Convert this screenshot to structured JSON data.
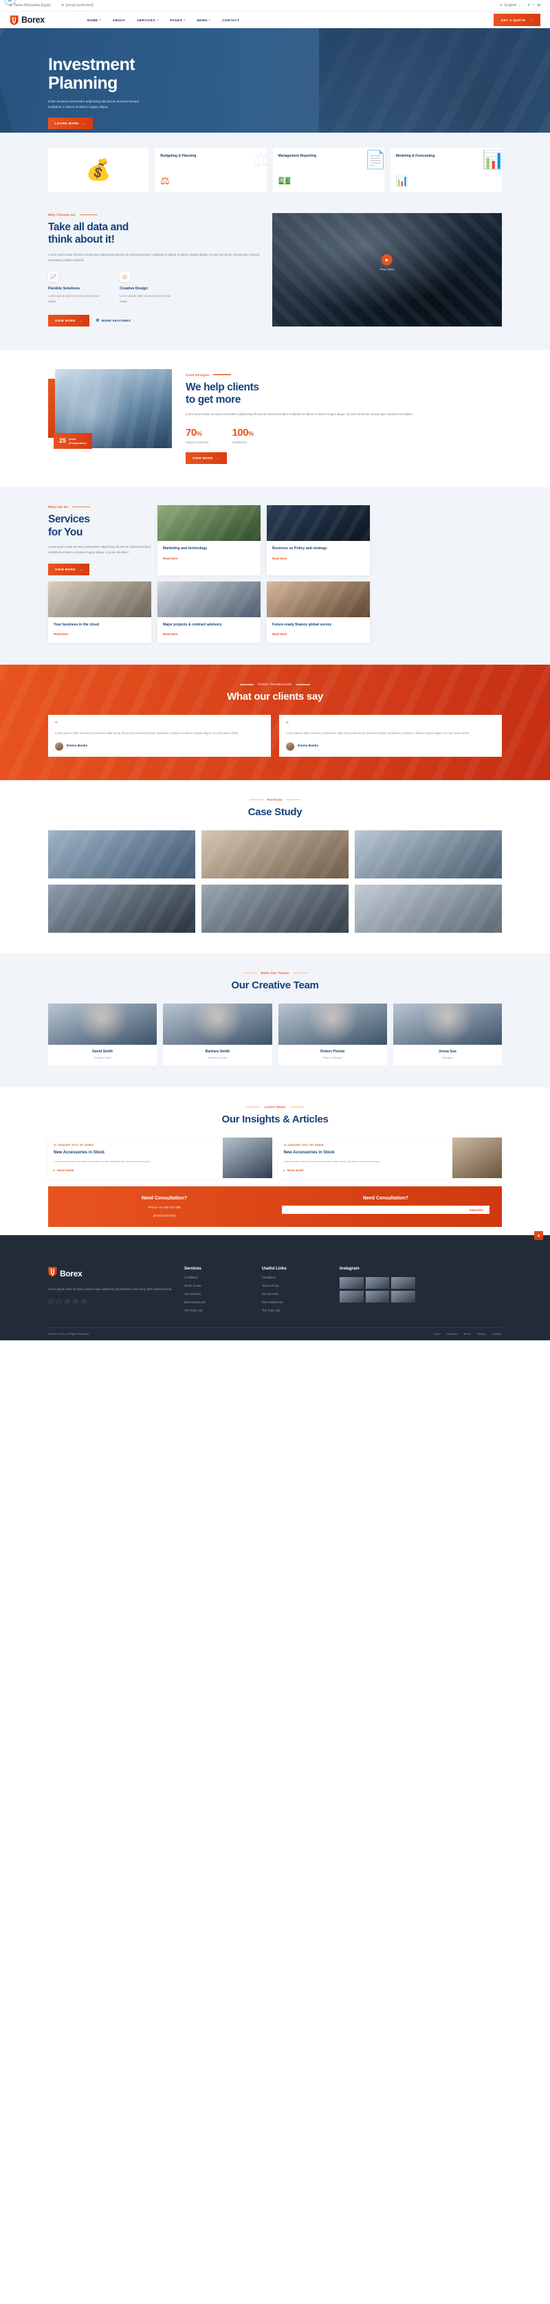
{
  "topbar": {
    "location": "Tanta AlGharbia,Egypt.",
    "location_icon": "map-pin-icon",
    "email": "[email protected]",
    "email_icon": "envelope-icon",
    "language": "English",
    "language_icon": "globe-icon",
    "language_caret": "⌄",
    "social": [
      "f",
      "ᵛ",
      "in"
    ]
  },
  "header": {
    "brand": "Borex",
    "nav": [
      {
        "label": "HOME",
        "caret": "▾"
      },
      {
        "label": "ABOUT",
        "caret": ""
      },
      {
        "label": "SERVICES",
        "caret": "▾"
      },
      {
        "label": "PAGES",
        "caret": "▾"
      },
      {
        "label": "NEWS",
        "caret": "▾"
      },
      {
        "label": "CONTACT",
        "caret": ""
      }
    ],
    "cta": "GET A QUOTE",
    "cta_arrow": "→"
  },
  "hero": {
    "title_line1": "Investment",
    "title_line2": "Planning",
    "paragraph": "Dolor sit amet,consectetur adipisicing elit,sed do eiusmod tempor incididunt ut labore et dolore magna aliqua.",
    "button": "LEARN MORE",
    "button_arrow": "→"
  },
  "feature_cards": [
    {
      "title": "",
      "icon": "money-growth-art",
      "glyph": "💰"
    },
    {
      "title": "Budgeting\n& Planning",
      "icon": "scales-icon",
      "glyph": "⚖"
    },
    {
      "title": "Management\nReporting",
      "icon": "document-icon",
      "glyph": "💵"
    },
    {
      "title": "Modeling\n& Forecasting",
      "icon": "chart-icon",
      "glyph": "📊"
    }
  ],
  "why": {
    "eyebrow": "Why Choose Us",
    "heading_line1": "Take all data and",
    "heading_line2": "think about it!",
    "paragraph": "Lorem ipsum dolor sit amet,consectetur adipisicing elit,sed do eiusmod tempor incididunt ut labore et dolore magna aliqua. Ut enim ad minim veniam,quis nostrud exercitation ullamco laboris",
    "features": [
      {
        "title": "Flexible Solutions",
        "text": "Lorem ipsum dolor sit amet,consec tetur adipis",
        "icon": "bar-chart-icon",
        "glyph": "📈"
      },
      {
        "title": "Creative Design",
        "text": "Lorem ipsum dolor sit amet,consec tetur adipis",
        "icon": "target-icon",
        "glyph": "◎"
      }
    ],
    "btn_primary": "VIEW MORE",
    "btn_primary_arrow": "→",
    "btn_secondary": "MORE FEATURES",
    "btn_secondary_icon": "plus-circle-icon",
    "play_label": "Play video",
    "play_icon": "play-icon"
  },
  "help": {
    "eyebrow": "Case Designs",
    "heading_line1": "We help clients",
    "heading_line2": "to get more",
    "paragraph": "Lorem ipsum dolor sit amet,consectetur adipisicing elit,sed do eiusmod tempor incididunt ut labore et dolore magna aliqua. Ut enim ad minim veniam,quis nostrud exercitation",
    "stats": [
      {
        "value": "70",
        "unit": "%",
        "label": "Happy Customers"
      },
      {
        "value": "100",
        "unit": "%",
        "label": "Satisfaction"
      }
    ],
    "badge_number": "25",
    "badge_text_line1": "years",
    "badge_text_line2": "of experience",
    "button": "VIEW MORE",
    "button_arrow": "→"
  },
  "services": {
    "eyebrow": "What we do",
    "heading_line1": "Services",
    "heading_line2": "for You",
    "paragraph": "Lorem ipsum dolor sit amet,consectetur adipisicing elit,sed do eiusmod tempor incididunt ut labore et dolore magna aliqua. Ut enim ad minim",
    "button": "VIEW MORE",
    "button_arrow": "→",
    "read_more": "Read More",
    "cards": [
      {
        "title": "Marketing and technology",
        "badge": "💼",
        "badge_name": "briefcase-icon"
      },
      {
        "title": "Business us Policy and strategy",
        "badge": "📈",
        "badge_name": "chart-up-icon"
      },
      {
        "title": "Your business in the cloud",
        "badge": "☁",
        "badge_name": "cloud-icon"
      },
      {
        "title": "Major projects & contract advisory",
        "badge": "✎",
        "badge_name": "pencil-icon"
      },
      {
        "title": "Future-ready finance global survey",
        "badge": "🌐",
        "badge_name": "globe-icon"
      }
    ]
  },
  "testimonials": {
    "eyebrow": "Client Testimonials",
    "heading": "What our clients say",
    "items": [
      {
        "quote": "Lorem ipsum dolor sit amet,consectetur adipi sicing elit,sed do eiusmod tempor incididunt ut labore et dolore magna aliqua. Ut enim ipsum dolor",
        "name": "Emma Banks"
      },
      {
        "quote": "Lorem ipsum dolor sit amet,consectetur adipi sicing elit,sed do eiusmod tempor incididunt ut labore et dolore magna aliqua. Ut enim ipsum dolor",
        "name": "Emma Banks"
      }
    ]
  },
  "case_study": {
    "eyebrow": "Portfolio",
    "heading": "Case Study",
    "cells": [
      "case-image-1",
      "case-image-2",
      "case-image-3",
      "case-image-4",
      "case-image-5",
      "case-image-6"
    ]
  },
  "team": {
    "eyebrow": "Meet Our Teams",
    "heading": "Our Creative Team",
    "members": [
      {
        "name": "David Smith",
        "role": "Design Expert"
      },
      {
        "name": "Barbara Smith",
        "role": "painting director"
      },
      {
        "name": "Robert Pineda",
        "role": "Project Manager"
      },
      {
        "name": "Jenna Sue",
        "role": "Manager"
      }
    ]
  },
  "insights": {
    "eyebrow": "Latest News",
    "heading": "Our Insights & Articles",
    "posts": [
      {
        "meta": "22 JANUARY 2020 / BY ADMIN",
        "title": "New Accessories in Stock",
        "text": "Lorem ipsum dolor sit amet,consectetur adipi sicing elit,sed do eiusmod tempor.",
        "link": "READ MORE"
      },
      {
        "meta": "22 JANUARY 2020 / BY ADMIN",
        "title": "New Accessories in Stock",
        "text": "Lorem ipsum dolor sit amet,consectetur adipi sicing elit,sed do eiusmod tempor.",
        "link": "READ MORE"
      }
    ]
  },
  "cta": {
    "left_title": "Need Consultation?",
    "phone_label": "Phone:+44 056 978 199",
    "email_label": "[email protected]",
    "right_title": "Need Consultation?",
    "input_placeholder": "",
    "button": "Subscribe"
  },
  "footer": {
    "brand": "Borex",
    "about": "Lorem ipsum dolor sit amet,consect etuer adipiscing elit,sed diam nonu mmy nibh euismod tincid",
    "social": [
      "f",
      "ᵛ",
      "G",
      "in",
      "P"
    ],
    "columns": [
      {
        "title": "Services",
        "links": [
          "Conditions",
          "Terms of Use",
          "Our Services",
          "New Guests List",
          "The Team List"
        ]
      },
      {
        "title": "Useful Links",
        "links": [
          "Conditions",
          "Terms of Use",
          "Our Services",
          "New Guests List",
          "The Team List"
        ]
      }
    ],
    "instagram_title": "Instagram",
    "copyright": "© Borex 2020 | All Rights Reserved",
    "bottom_links": [
      "Home",
      "About Us",
      "Terms",
      "Privacy",
      "Contacts"
    ],
    "to_top_icon": "arrow-up-icon"
  },
  "colors": {
    "brand_orange": "#e8541f",
    "deep_blue": "#16427a",
    "hero_blue": "#2e5e8c",
    "footer_dark": "#242b38",
    "light_bg": "#f1f4f8"
  }
}
